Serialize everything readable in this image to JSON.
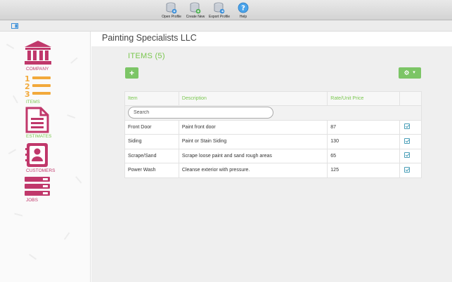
{
  "toolbar": {
    "open_profile": "Open Profile",
    "create_new": "Create New",
    "export_profile": "Export Profile",
    "help": "Help"
  },
  "sidebar": {
    "items": [
      {
        "label": "COMPANY",
        "icon": "bank-icon"
      },
      {
        "label": "ITEMS",
        "icon": "numbered-list-icon"
      },
      {
        "label": "ESTIMATES",
        "icon": "document-icon"
      },
      {
        "label": "CUSTOMERS",
        "icon": "contacts-book-icon"
      },
      {
        "label": "JOBS",
        "icon": "stacked-bars-icon"
      }
    ]
  },
  "header": {
    "company_name": "Painting Specialists LLC"
  },
  "items_section": {
    "title": "ITEMS (5)",
    "add_label": "+",
    "settings_caret": "▾"
  },
  "table": {
    "columns": [
      "Item",
      "Description",
      "Rate/Unit Price",
      ""
    ],
    "search_placeholder": "Search",
    "rows": [
      {
        "item": "Front Door",
        "description": "Paint front door",
        "rate": "87"
      },
      {
        "item": "Siding",
        "description": "Paint or Stain Siding",
        "rate": "130"
      },
      {
        "item": "Scrape/Sand",
        "description": "Scrape loose paint and sand rough areas",
        "rate": "65"
      },
      {
        "item": "Power Wash",
        "description": "Cleanse exterior with pressure.",
        "rate": "125"
      }
    ]
  },
  "colors": {
    "accent_green": "#7cc566",
    "brand_pink": "#c0386b",
    "brand_orange": "#f2a93b",
    "edit_blue": "#4b9fb8"
  }
}
